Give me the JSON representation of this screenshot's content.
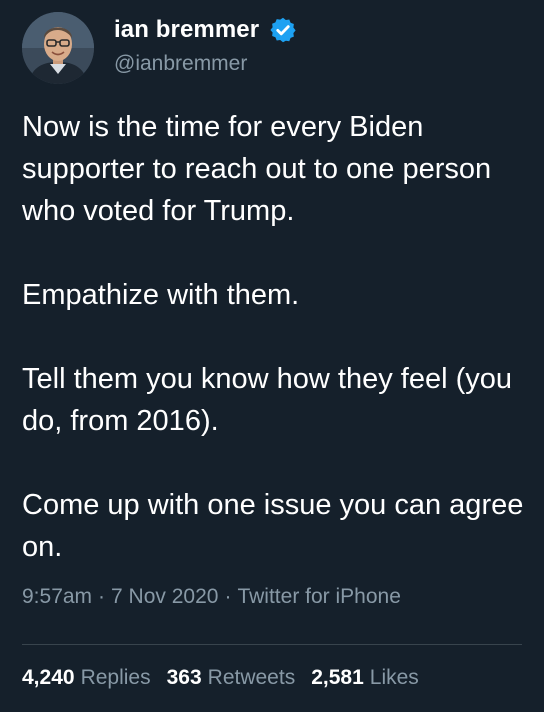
{
  "user": {
    "display_name": "ian bremmer",
    "handle": "@ianbremmer",
    "verified": true,
    "verified_icon": "verified-badge-icon",
    "avatar_icon": "avatar-photo"
  },
  "tweet": {
    "paragraphs": [
      "Now is the time for every Biden supporter to reach out to one person who voted for Trump.",
      "Empathize with them.",
      "Tell them you know how they feel (you do, from 2016).",
      "Come up with one issue you can agree on."
    ]
  },
  "meta": {
    "time": "9:57am",
    "separator": "·",
    "date": "7 Nov 2020",
    "source": "Twitter for iPhone"
  },
  "stats": {
    "replies": {
      "count": "4,240",
      "label": "Replies"
    },
    "retweets": {
      "count": "363",
      "label": "Retweets"
    },
    "likes": {
      "count": "2,581",
      "label": "Likes"
    }
  },
  "colors": {
    "background": "#15202b",
    "text": "#ffffff",
    "secondary_text": "#8899a6",
    "verified": "#1da1f2",
    "divider": "#38444d"
  }
}
